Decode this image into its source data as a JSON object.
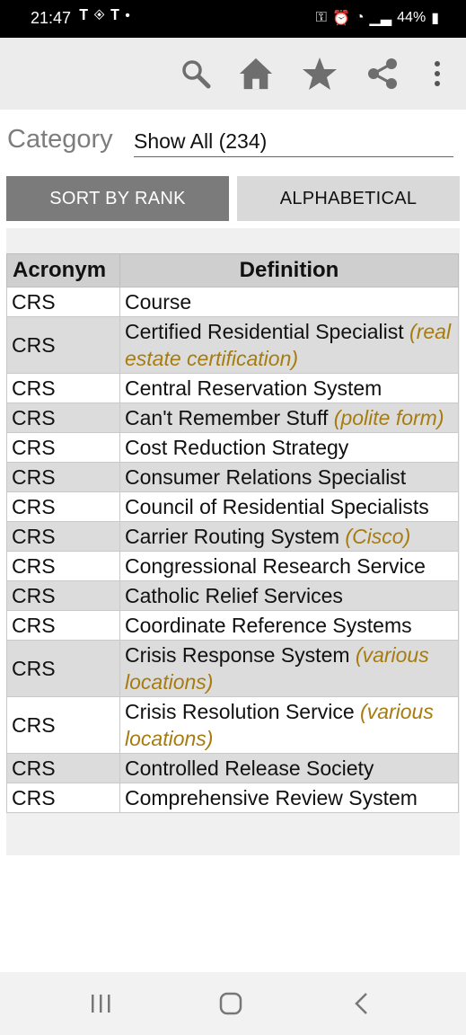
{
  "status": {
    "time": "21:47",
    "battery": "44%"
  },
  "toolbar": {
    "icons": [
      "search-icon",
      "home-icon",
      "star-icon",
      "share-icon",
      "more-vert-icon"
    ]
  },
  "category": {
    "label": "Category",
    "value": "Show All (234)"
  },
  "sort": {
    "rank_label": "SORT BY RANK",
    "alpha_label": "ALPHABETICAL"
  },
  "table": {
    "headers": [
      "Acronym",
      "Definition"
    ],
    "rows": [
      {
        "acronym": "CRS",
        "definition": "Course",
        "note": ""
      },
      {
        "acronym": "CRS",
        "definition": "Certified Residential Specialist",
        "note": "(real estate certification)"
      },
      {
        "acronym": "CRS",
        "definition": "Central Reservation System",
        "note": ""
      },
      {
        "acronym": "CRS",
        "definition": "Can't Remember Stuff",
        "note": "(polite form)"
      },
      {
        "acronym": "CRS",
        "definition": "Cost Reduction Strategy",
        "note": ""
      },
      {
        "acronym": "CRS",
        "definition": "Consumer Relations Specialist",
        "note": ""
      },
      {
        "acronym": "CRS",
        "definition": "Council of Residential Specialists",
        "note": ""
      },
      {
        "acronym": "CRS",
        "definition": "Carrier Routing System",
        "note": "(Cisco)"
      },
      {
        "acronym": "CRS",
        "definition": "Congressional Research Service",
        "note": ""
      },
      {
        "acronym": "CRS",
        "definition": "Catholic Relief Services",
        "note": ""
      },
      {
        "acronym": "CRS",
        "definition": "Coordinate Reference Systems",
        "note": ""
      },
      {
        "acronym": "CRS",
        "definition": "Crisis Response System",
        "note": "(various locations)"
      },
      {
        "acronym": "CRS",
        "definition": "Crisis Resolution Service",
        "note": "(various locations)"
      },
      {
        "acronym": "CRS",
        "definition": "Controlled Release Society",
        "note": ""
      },
      {
        "acronym": "CRS",
        "definition": "Comprehensive Review System",
        "note": ""
      }
    ]
  },
  "nav": {
    "icons": [
      "recents-icon",
      "home-circle-icon",
      "back-icon"
    ]
  },
  "colors": {
    "accent_note": "#a77c0f",
    "sort_active": "#7b7b7b",
    "sort_inactive": "#d9d9d9"
  }
}
